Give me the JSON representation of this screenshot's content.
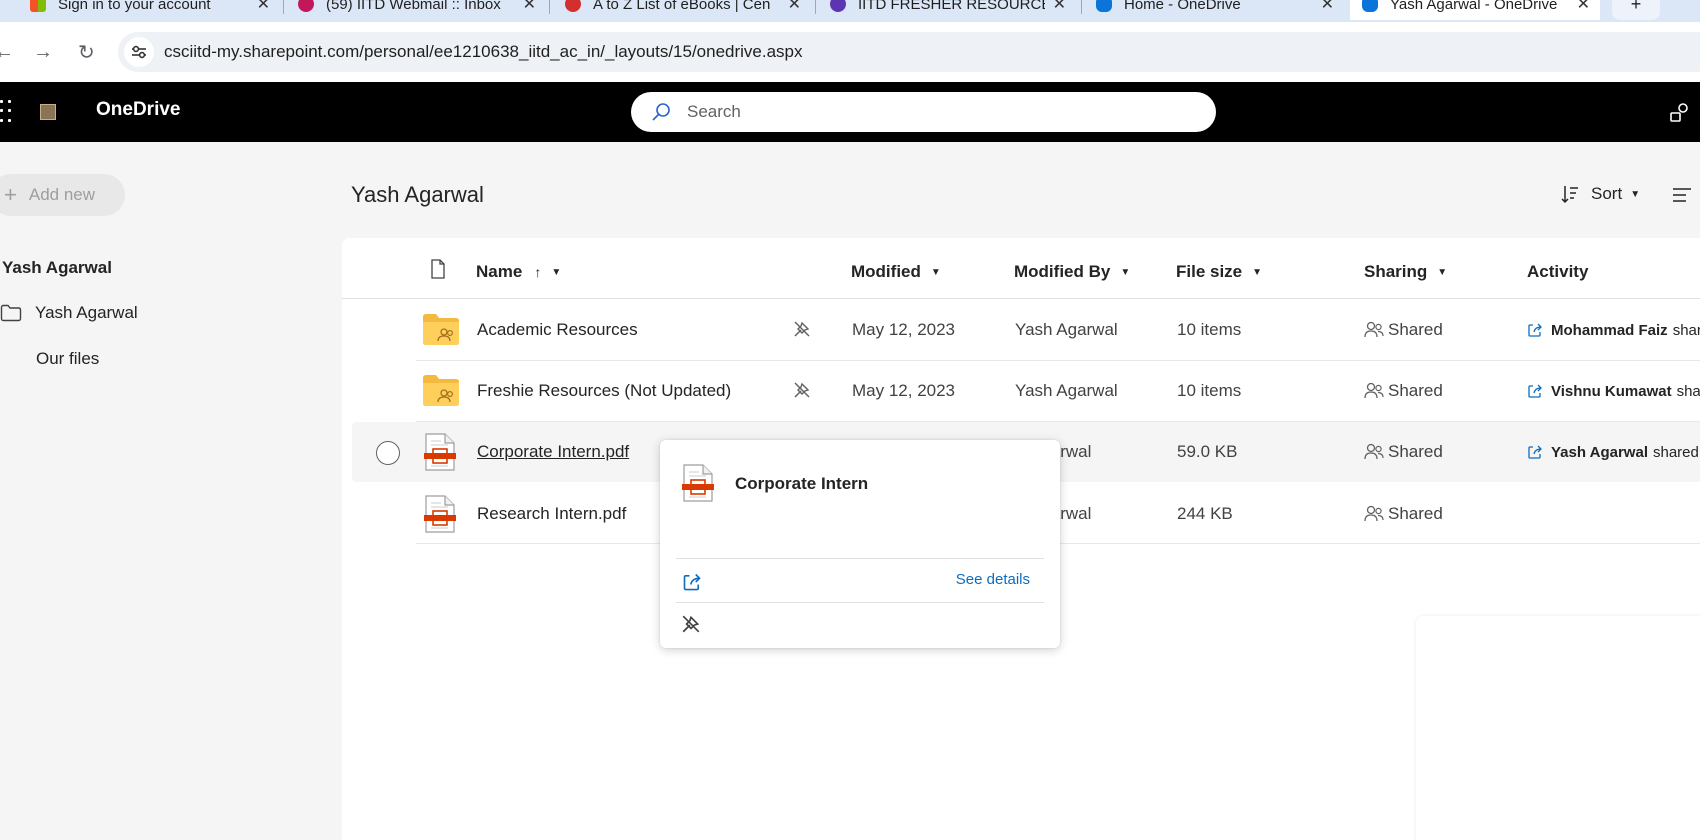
{
  "browser": {
    "tabs": [
      {
        "title": "Sign in to your account",
        "favicon_color": "#f35325",
        "active": false
      },
      {
        "title": "(59) IITD Webmail :: Inbox",
        "favicon_color": "#c2185b",
        "active": false
      },
      {
        "title": "A to Z List of eBooks | Cen",
        "favicon_color": "#d32f2f",
        "active": false
      },
      {
        "title": "IITD FRESHER RESOURCES",
        "favicon_color": "#5e35b1",
        "active": false
      },
      {
        "title": "Home - OneDrive",
        "favicon_color": "#0a74da",
        "active": false
      },
      {
        "title": "Yash Agarwal - OneDrive",
        "favicon_color": "#0a74da",
        "active": true
      }
    ],
    "url": "csciitd-my.sharepoint.com/personal/ee1210638_iitd_ac_in/_layouts/15/onedrive.aspx"
  },
  "suite": {
    "app_title": "OneDrive",
    "search_placeholder": "Search"
  },
  "leftnav": {
    "add_new": "Add new",
    "owner": "Yash Agarwal",
    "items": [
      {
        "label": "Yash Agarwal"
      },
      {
        "label": "Our files"
      }
    ]
  },
  "main": {
    "title": "Yash Agarwal",
    "sort_label": "Sort",
    "columns": {
      "name": "Name",
      "modified": "Modified",
      "modified_by": "Modified By",
      "file_size": "File size",
      "sharing": "Sharing",
      "activity": "Activity"
    },
    "rows": [
      {
        "name": "Academic Resources",
        "type": "shared-folder",
        "modified": "May 12, 2023",
        "modified_by": "Yash Agarwal",
        "size": "10 items",
        "sharing": "Shared",
        "activity_user": "Mohammad Faiz",
        "activity_text": "share"
      },
      {
        "name": "Freshie Resources (Not Updated)",
        "type": "shared-folder",
        "modified": "May 12, 2023",
        "modified_by": "Yash Agarwal",
        "size": "10 items",
        "sharing": "Shared",
        "activity_user": "Vishnu Kumawat",
        "activity_text": "share"
      },
      {
        "name": "Corporate Intern.pdf",
        "type": "pdf",
        "modified": "",
        "modified_by": "Agarwal",
        "size": "59.0 KB",
        "sharing": "Shared",
        "activity_user": "Yash Agarwal",
        "activity_text": "shared t"
      },
      {
        "name": "Research Intern.pdf",
        "type": "pdf",
        "modified": "",
        "modified_by": "Agarwal",
        "size": "244 KB",
        "sharing": "Shared",
        "activity_user": "",
        "activity_text": ""
      }
    ]
  },
  "hovercard": {
    "title": "Corporate Intern",
    "see_details": "See details"
  }
}
